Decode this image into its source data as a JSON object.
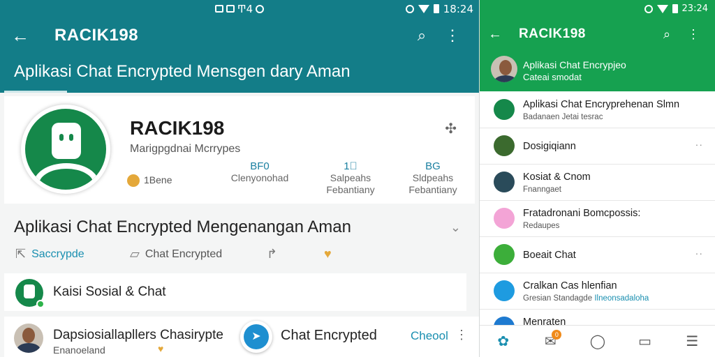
{
  "left": {
    "status": {
      "left_text": "Ͳ4",
      "time": "18:24"
    },
    "appbar": {
      "title": "RACIK198",
      "subtitle": "Aplikasi Chat Encrypted Mensgen dary Aman"
    },
    "profile": {
      "name": "RACIK198",
      "sub": "Marigpgdnai Mcrrypes",
      "stat1": "1Bene",
      "stat2_value": "BF0",
      "stat2_label": "Clenyonohad",
      "stat3_value": "1⃞",
      "stat3_label": "Salpeahs\nFebantiany",
      "stat4_value": "BG",
      "stat4_label": "Sldpeahs\nFebantiany"
    },
    "row_title": "Aplikasi Chat Encrypted Mengenangan Aman",
    "actions": {
      "a1": "Saccrypde",
      "a2": "Chat Encrypted"
    },
    "card2": {
      "label": "Kaisi Sosial & Chat"
    },
    "card3": {
      "name": "Dapsiosiallapllers Chasirypte",
      "sub": "Enanoeland",
      "chat_label": "Chat Encrypted",
      "check": "Cheool"
    }
  },
  "right": {
    "status": {
      "time": "23:24"
    },
    "appbar": {
      "title": "RACIK198"
    },
    "header": {
      "title": "Aplikasi Chat Encrypjeo",
      "sub": "Cateai smodat"
    },
    "items": [
      {
        "title": "Aplikasi Chat Encryprehenan Slmn",
        "sub": "Badanaen Jetai tesrac",
        "color": "#15884a"
      },
      {
        "title": "Dosigiqiann",
        "sub": "",
        "color": "#3b6a2e"
      },
      {
        "title": "Kosiat & Cnom",
        "sub": "Fnanngaet",
        "color": "#2a4b5a"
      },
      {
        "title": "Fratadronani Bomcpossis:",
        "sub": "Redaupes",
        "color": "#f3a4d6"
      },
      {
        "title": "Boeait Chat",
        "sub": "",
        "color": "#3cae3a"
      },
      {
        "title": "Cralkan Cas hlenfian",
        "sub": "Gresian Standagde",
        "sub_hl": "Ilneonsadaloha",
        "color": "#1e9be0"
      },
      {
        "title": "Menraten",
        "sub": "",
        "color": "#1e7ad0"
      }
    ],
    "nav_badge": "0"
  },
  "colors": {
    "teal": "#137d88",
    "green": "#16a150",
    "accent": "#1a8fb0"
  }
}
